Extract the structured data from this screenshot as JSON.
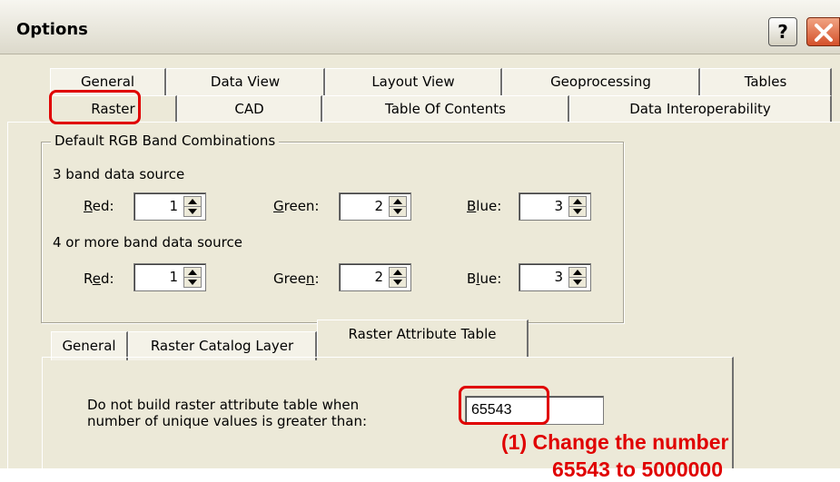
{
  "window": {
    "title": "Options",
    "help_label": "?"
  },
  "tabs_row1": [
    "General",
    "Data View",
    "Layout View",
    "Geoprocessing",
    "Tables"
  ],
  "tabs_row2": [
    "Raster",
    "CAD",
    "Table Of Contents",
    "Data Interoperability"
  ],
  "rgb_group": {
    "legend": "Default RGB Band Combinations",
    "three_band_label": "3 band data source",
    "four_band_label": "4 or more band data source",
    "three_band": {
      "red_label_u": "R",
      "red_label_rest": "ed:",
      "red_value": "1",
      "green_label_u": "G",
      "green_label_rest": "reen:",
      "green_value": "2",
      "blue_label_u": "B",
      "blue_label_rest": "lue:",
      "blue_value": "3"
    },
    "four_band": {
      "red_label_pre": "R",
      "red_label_u": "e",
      "red_label_rest": "d:",
      "red_value": "1",
      "green_label_pre": "Gree",
      "green_label_u": "n",
      "green_label_rest": ":",
      "green_value": "2",
      "blue_label_pre": "B",
      "blue_label_u": "l",
      "blue_label_rest": "ue:",
      "blue_value": "3"
    }
  },
  "sub_tabs": [
    "General",
    "Raster Catalog Layer",
    "Raster Attribute Table"
  ],
  "attribute_table": {
    "description_line1": "Do not build raster attribute table when",
    "description_line2": "number of unique values is greater than:",
    "threshold_value": "65543"
  },
  "annotation": {
    "line1": "(1)  Change the number",
    "line2": "65543 to 5000000",
    "color": "#e00000"
  }
}
